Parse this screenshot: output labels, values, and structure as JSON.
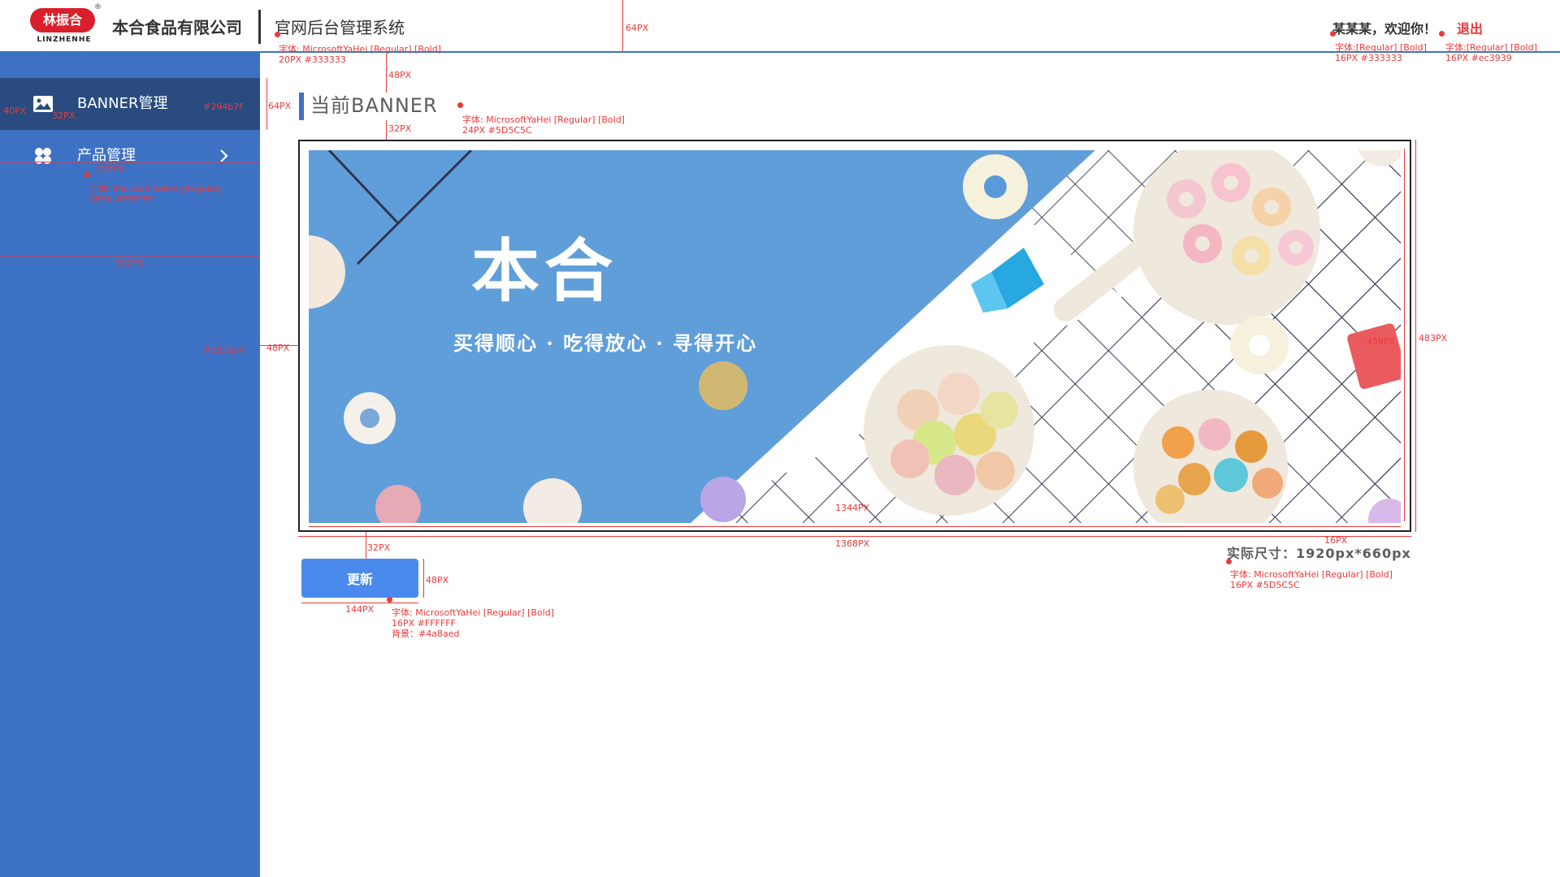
{
  "header": {
    "logo_text": "林振合",
    "logo_sub": "LINZHENHE",
    "logo_reg": "®",
    "company": "本合食品有限公司",
    "system_title": "官网后台管理系统",
    "welcome": "某某某，欢迎你！",
    "logout": "退出"
  },
  "sidebar": {
    "items": [
      {
        "label": "BANNER管理",
        "icon": "image-icon",
        "active": true
      },
      {
        "label": "产品管理",
        "icon": "grid-icon",
        "active": false,
        "has_submenu": true
      }
    ]
  },
  "main": {
    "section_title": "当前BANNER",
    "banner": {
      "title": "本合",
      "slogan": "买得顺心 · 吃得放心 · 寻得开心"
    },
    "update_button": "更新",
    "actual_size": "实际尺寸：1920px*660px"
  },
  "annotations": {
    "header_height": "64PX",
    "title_font": "字体: MicrosoftYaHei [Regular] [Bold]\n20PX #333333",
    "welcome_font": "字体:[Regular] [Bold]\n16PX #333333",
    "logout_font": "字体:[Regular] [Bold]\n16PX #ec3939",
    "gap_48": "48PX",
    "menu_height": "64PX",
    "icon_left": "40PX",
    "icon_size": "32PX",
    "active_color": "#294b7f",
    "label_width": "272PX",
    "menu_font": "字体: MicrosoftYaHei [Regular]\n18PX #FFFFFF",
    "sidebar_width": "320PX",
    "sidebar_color": "#3d71c4",
    "content_left": "48PX",
    "section_gap": "32PX",
    "section_font": "字体: MicrosoftYaHei [Regular] [Bold]\n24PX #5D5C5C",
    "frame_height": "483PX",
    "image_height": "459PX",
    "image_width": "1344PX",
    "frame_width": "1368PX",
    "inner_padding": "16PX",
    "btn_gap": "32PX",
    "btn_height": "48PX",
    "btn_width": "144PX",
    "btn_font": "字体: MicrosoftYaHei [Regular] [Bold]\n16PX #FFFFFF\n背景：#4a8aed",
    "size_font": "字体: MicrosoftYaHei [Regular] [Bold]\n16PX #5D5C5C"
  }
}
